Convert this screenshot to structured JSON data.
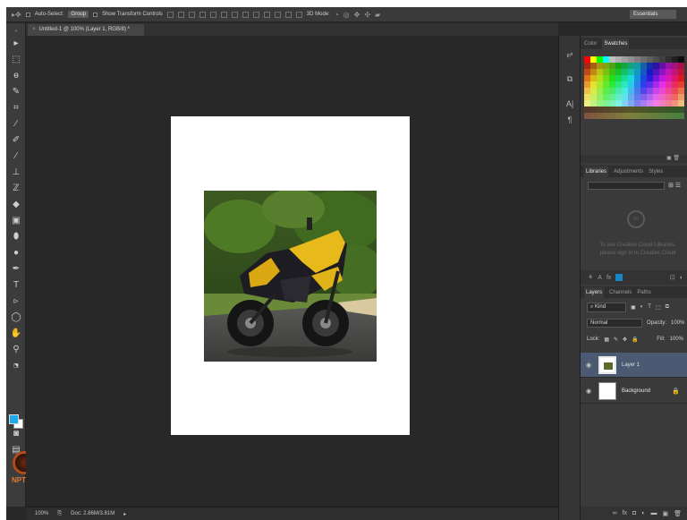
{
  "options_bar": {
    "auto_select_label": "Auto-Select:",
    "auto_select_value": "Group",
    "show_transform_label": "Show Transform Controls",
    "mode_3d_label": "3D Mode:",
    "workspace": "Essentials"
  },
  "document": {
    "tab_title": "Untitled-1 @ 100% (Layer 1, RGB/8) *",
    "close_glyph": "×"
  },
  "status": {
    "zoom": "100%",
    "doc_info": "Doc: 2.86M/3.81M"
  },
  "color_panel": {
    "tabs": [
      "Color",
      "Swatches"
    ],
    "active": "Swatches"
  },
  "libraries_panel": {
    "tabs": [
      "Libraries",
      "Adjustments",
      "Styles"
    ],
    "message_line1": "To use Creative Cloud Libraries,",
    "message_line2": "please sign in to Creative Cloud"
  },
  "layers_panel": {
    "tabs": [
      "Layers",
      "Channels",
      "Paths"
    ],
    "kind_label": "Kind",
    "blend_mode": "Normal",
    "opacity_label": "Opacity:",
    "opacity_value": "100%",
    "lock_label": "Lock:",
    "fill_label": "Fill:",
    "fill_value": "100%",
    "layers": [
      {
        "name": "Layer 1",
        "selected": true
      },
      {
        "name": "Background",
        "selected": false
      }
    ]
  },
  "branding": {
    "logo_text": "NPTEL"
  },
  "colors": {
    "foreground": "#1fa9ef",
    "background": "#ffffff",
    "selection": "#4b5a72"
  }
}
